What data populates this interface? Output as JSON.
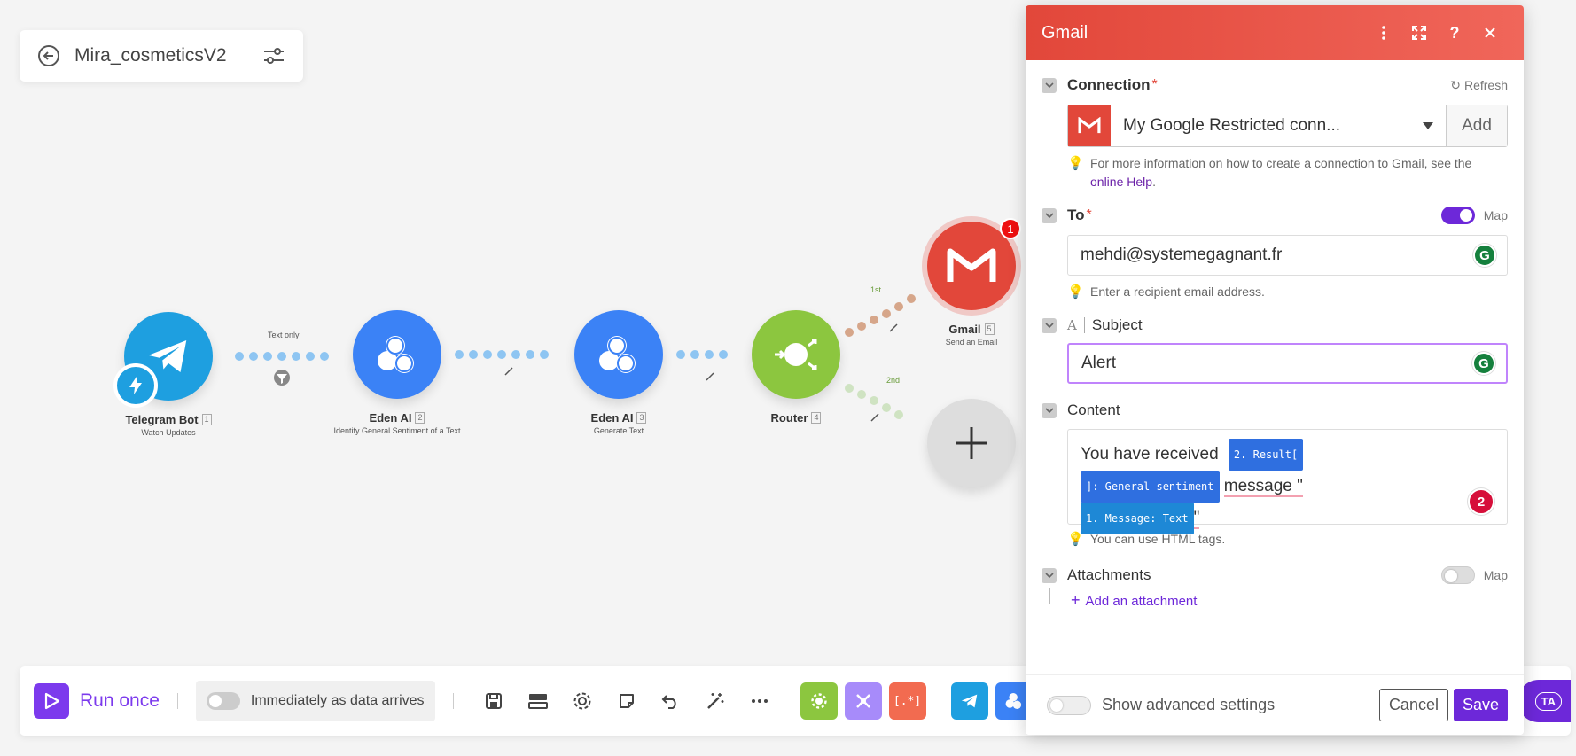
{
  "scenario": {
    "name": "Mira_cosmeticsV2"
  },
  "nodes": [
    {
      "title": "Telegram Bot",
      "index": "1",
      "subtitle": "Watch Updates"
    },
    {
      "title": "Eden AI",
      "index": "2",
      "subtitle": "Identify General Sentiment of a Text"
    },
    {
      "title": "Eden AI",
      "index": "3",
      "subtitle": "Generate Text"
    },
    {
      "title": "Router",
      "index": "4",
      "subtitle": ""
    },
    {
      "title": "Gmail",
      "index": "5",
      "subtitle": "Send an Email",
      "badge": "1"
    }
  ],
  "routes": {
    "filter_label": "Text only",
    "first": "1st",
    "second": "2nd"
  },
  "panel": {
    "title": "Gmail",
    "connection": {
      "label": "Connection",
      "refresh": "Refresh",
      "value": "My Google Restricted conn...",
      "add": "Add",
      "hint_pre": "For more information on how to create a connection to Gmail, see the ",
      "hint_link": "online Help",
      "hint_post": "."
    },
    "to": {
      "label": "To",
      "map": "Map",
      "value": "mehdi@systemegagnant.fr",
      "hint": "Enter a recipient email address."
    },
    "subject": {
      "label": "Subject",
      "type_icon": "A",
      "value": "Alert"
    },
    "content": {
      "label": "Content",
      "text1": "You have received",
      "pill1a": "2. Result[",
      "pill1b": "]: General sentiment",
      "text2": "message \"",
      "pill2": "1. Message: Text",
      "text3": "\"",
      "badge": "2",
      "hint": "You can use HTML tags."
    },
    "attachments": {
      "label": "Attachments",
      "map": "Map",
      "add": "Add an attachment"
    },
    "footer": {
      "advanced": "Show advanced settings",
      "cancel": "Cancel",
      "save": "Save"
    }
  },
  "toolbar": {
    "run_once": "Run once",
    "schedule": "Immediately as data arrives",
    "partial_label": "TA"
  },
  "colors": {
    "purple": "#7c3aed",
    "telegram": "#1e9fe0",
    "eden": "#3b82f6",
    "router": "#8cc63f",
    "gmail": "#e2473a",
    "pill_blue": "#2f6fe0",
    "pill_cyan": "#1e88d6"
  }
}
